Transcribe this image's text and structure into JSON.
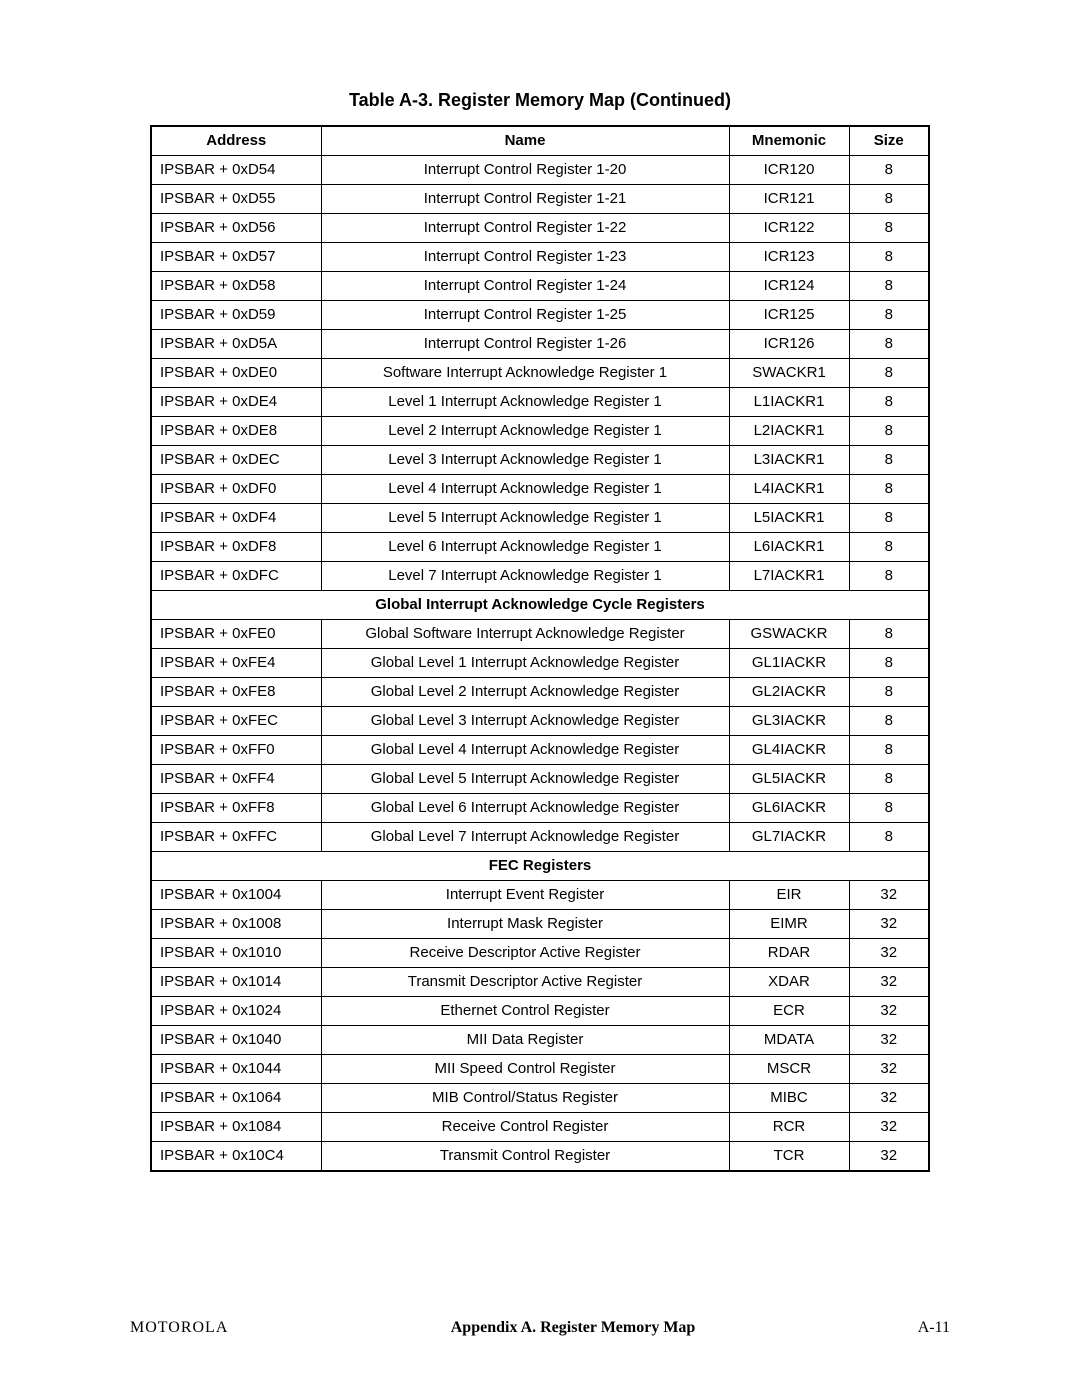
{
  "caption": "Table A-3. Register Memory Map (Continued)",
  "headers": {
    "address": "Address",
    "name": "Name",
    "mnemonic": "Mnemonic",
    "size": "Size"
  },
  "rows": [
    {
      "type": "data",
      "address": "IPSBAR + 0xD54",
      "name": "Interrupt Control Register 1-20",
      "mnemonic": "ICR120",
      "size": "8"
    },
    {
      "type": "data",
      "address": "IPSBAR + 0xD55",
      "name": "Interrupt Control Register 1-21",
      "mnemonic": "ICR121",
      "size": "8"
    },
    {
      "type": "data",
      "address": "IPSBAR + 0xD56",
      "name": "Interrupt Control Register 1-22",
      "mnemonic": "ICR122",
      "size": "8"
    },
    {
      "type": "data",
      "address": "IPSBAR + 0xD57",
      "name": "Interrupt Control Register 1-23",
      "mnemonic": "ICR123",
      "size": "8"
    },
    {
      "type": "data",
      "address": "IPSBAR + 0xD58",
      "name": "Interrupt Control Register 1-24",
      "mnemonic": "ICR124",
      "size": "8"
    },
    {
      "type": "data",
      "address": "IPSBAR + 0xD59",
      "name": "Interrupt Control Register 1-25",
      "mnemonic": "ICR125",
      "size": "8"
    },
    {
      "type": "data",
      "address": "IPSBAR + 0xD5A",
      "name": "Interrupt Control Register 1-26",
      "mnemonic": "ICR126",
      "size": "8"
    },
    {
      "type": "data",
      "address": "IPSBAR + 0xDE0",
      "name": "Software Interrupt Acknowledge Register 1",
      "mnemonic": "SWACKR1",
      "size": "8"
    },
    {
      "type": "data",
      "address": "IPSBAR + 0xDE4",
      "name": "Level 1 Interrupt Acknowledge Register 1",
      "mnemonic": "L1IACKR1",
      "size": "8"
    },
    {
      "type": "data",
      "address": "IPSBAR + 0xDE8",
      "name": "Level 2 Interrupt Acknowledge Register 1",
      "mnemonic": "L2IACKR1",
      "size": "8"
    },
    {
      "type": "data",
      "address": "IPSBAR + 0xDEC",
      "name": "Level 3 Interrupt Acknowledge Register 1",
      "mnemonic": "L3IACKR1",
      "size": "8"
    },
    {
      "type": "data",
      "address": "IPSBAR + 0xDF0",
      "name": "Level 4 Interrupt Acknowledge Register 1",
      "mnemonic": "L4IACKR1",
      "size": "8"
    },
    {
      "type": "data",
      "address": "IPSBAR + 0xDF4",
      "name": "Level 5 Interrupt Acknowledge Register 1",
      "mnemonic": "L5IACKR1",
      "size": "8"
    },
    {
      "type": "data",
      "address": "IPSBAR + 0xDF8",
      "name": "Level 6 Interrupt Acknowledge Register 1",
      "mnemonic": "L6IACKR1",
      "size": "8"
    },
    {
      "type": "data",
      "address": "IPSBAR + 0xDFC",
      "name": "Level 7 Interrupt Acknowledge Register 1",
      "mnemonic": "L7IACKR1",
      "size": "8"
    },
    {
      "type": "section",
      "label": "Global Interrupt Acknowledge Cycle Registers"
    },
    {
      "type": "data",
      "address": "IPSBAR + 0xFE0",
      "name": "Global Software Interrupt Acknowledge Register",
      "mnemonic": "GSWACKR",
      "size": "8"
    },
    {
      "type": "data",
      "address": "IPSBAR + 0xFE4",
      "name": "Global Level 1 Interrupt Acknowledge Register",
      "mnemonic": "GL1IACKR",
      "size": "8"
    },
    {
      "type": "data",
      "address": "IPSBAR + 0xFE8",
      "name": "Global Level 2 Interrupt Acknowledge Register",
      "mnemonic": "GL2IACKR",
      "size": "8"
    },
    {
      "type": "data",
      "address": "IPSBAR + 0xFEC",
      "name": "Global Level 3 Interrupt Acknowledge Register",
      "mnemonic": "GL3IACKR",
      "size": "8"
    },
    {
      "type": "data",
      "address": "IPSBAR + 0xFF0",
      "name": "Global Level 4 Interrupt Acknowledge Register",
      "mnemonic": "GL4IACKR",
      "size": "8"
    },
    {
      "type": "data",
      "address": "IPSBAR + 0xFF4",
      "name": "Global Level 5 Interrupt Acknowledge Register",
      "mnemonic": "GL5IACKR",
      "size": "8"
    },
    {
      "type": "data",
      "address": "IPSBAR + 0xFF8",
      "name": "Global Level 6 Interrupt Acknowledge Register",
      "mnemonic": "GL6IACKR",
      "size": "8"
    },
    {
      "type": "data",
      "address": "IPSBAR + 0xFFC",
      "name": "Global Level 7 Interrupt Acknowledge Register",
      "mnemonic": "GL7IACKR",
      "size": "8"
    },
    {
      "type": "section",
      "label": "FEC Registers"
    },
    {
      "type": "data",
      "address": "IPSBAR + 0x1004",
      "name": "Interrupt Event Register",
      "mnemonic": "EIR",
      "size": "32"
    },
    {
      "type": "data",
      "address": "IPSBAR + 0x1008",
      "name": "Interrupt Mask Register",
      "mnemonic": "EIMR",
      "size": "32"
    },
    {
      "type": "data",
      "address": "IPSBAR + 0x1010",
      "name": "Receive Descriptor Active Register",
      "mnemonic": "RDAR",
      "size": "32"
    },
    {
      "type": "data",
      "address": "IPSBAR + 0x1014",
      "name": "Transmit Descriptor Active Register",
      "mnemonic": "XDAR",
      "size": "32"
    },
    {
      "type": "data",
      "address": "IPSBAR + 0x1024",
      "name": "Ethernet Control Register",
      "mnemonic": "ECR",
      "size": "32"
    },
    {
      "type": "data",
      "address": "IPSBAR + 0x1040",
      "name": "MII Data Register",
      "mnemonic": "MDATA",
      "size": "32"
    },
    {
      "type": "data",
      "address": "IPSBAR + 0x1044",
      "name": "MII Speed Control Register",
      "mnemonic": "MSCR",
      "size": "32"
    },
    {
      "type": "data",
      "address": "IPSBAR + 0x1064",
      "name": "MIB Control/Status Register",
      "mnemonic": "MIBC",
      "size": "32"
    },
    {
      "type": "data",
      "address": "IPSBAR + 0x1084",
      "name": "Receive Control Register",
      "mnemonic": "RCR",
      "size": "32"
    },
    {
      "type": "data",
      "address": "IPSBAR + 0x10C4",
      "name": "Transmit Control Register",
      "mnemonic": "TCR",
      "size": "32"
    }
  ],
  "footer": {
    "brand": "MOTOROLA",
    "title": "Appendix A.  Register Memory Map",
    "pagenum": "A-11"
  }
}
